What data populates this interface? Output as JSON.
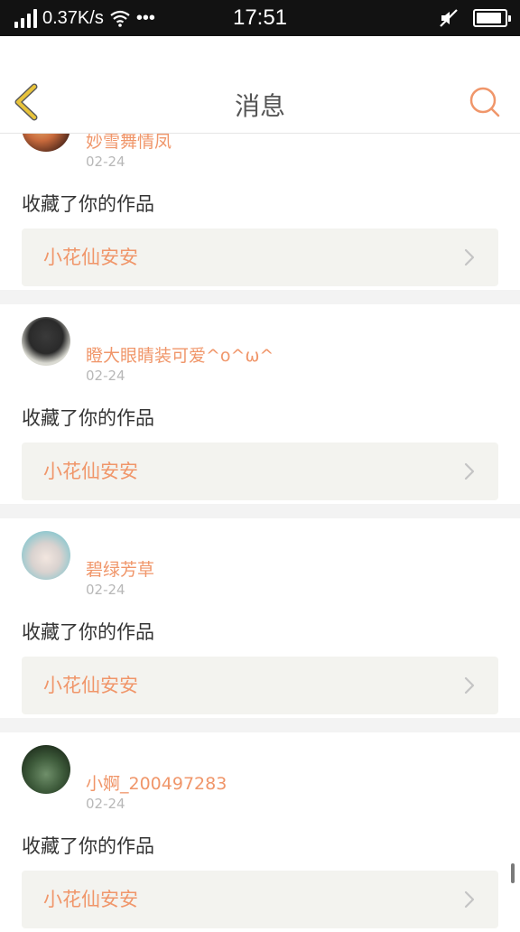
{
  "status_bar": {
    "speed": "0.37K/s",
    "dots": "•••",
    "time": "17:51",
    "battery_level": 0.9
  },
  "header": {
    "title": "消息",
    "back_icon": "chevron-left-icon",
    "search_icon": "search-icon"
  },
  "colors": {
    "accent": "#f0966a",
    "back_arrow": "#e8c33a",
    "box_bg": "#f3f3ef"
  },
  "messages": [
    {
      "username": "妙雪舞情凤",
      "date": "02-24",
      "action": "收藏了你的作品",
      "work": "小花仙安安"
    },
    {
      "username": "瞪大眼睛装可爱^o^ω^",
      "date": "02-24",
      "action": "收藏了你的作品",
      "work": "小花仙安安"
    },
    {
      "username": "碧绿芳草",
      "date": "02-24",
      "action": "收藏了你的作品",
      "work": "小花仙安安"
    },
    {
      "username": "小婀_200497283",
      "date": "02-24",
      "action": "收藏了你的作品",
      "work": "小花仙安安"
    }
  ]
}
